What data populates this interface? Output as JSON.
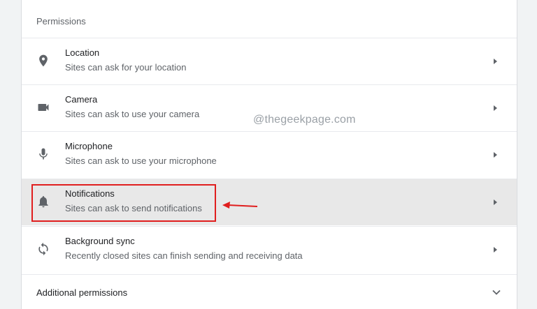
{
  "section_title": "Permissions",
  "rows": [
    {
      "icon": "location-pin-icon",
      "title": "Location",
      "subtitle": "Sites can ask for your location"
    },
    {
      "icon": "camera-icon",
      "title": "Camera",
      "subtitle": "Sites can ask to use your camera"
    },
    {
      "icon": "microphone-icon",
      "title": "Microphone",
      "subtitle": "Sites can ask to use your microphone"
    },
    {
      "icon": "bell-icon",
      "title": "Notifications",
      "subtitle": "Sites can ask to send notifications"
    },
    {
      "icon": "sync-icon",
      "title": "Background sync",
      "subtitle": "Recently closed sites can finish sending and receiving data"
    }
  ],
  "additional_permissions": "Additional permissions",
  "watermark": "@thegeekpage.com",
  "colors": {
    "highlight_row": "#e8e8e8",
    "annotation_red": "#e01e1e",
    "icon_gray": "#5f6368"
  }
}
